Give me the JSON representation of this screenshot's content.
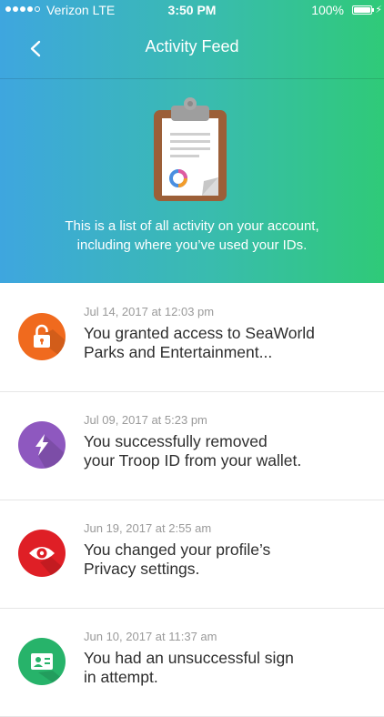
{
  "status_bar": {
    "carrier": "Verizon LTE",
    "time": "3:50 PM",
    "battery": "100%",
    "battery_level": 1.0
  },
  "nav": {
    "title": "Activity Feed",
    "back_icon": "chevron-left-icon"
  },
  "hero": {
    "icon": "clipboard-icon",
    "description_line1": "This is a list of all activity on your account,",
    "description_line2": "including where you’ve used your IDs."
  },
  "activity": [
    {
      "date": "Jul 14, 2017 at 12:03 pm",
      "line1": "You granted access to SeaWorld",
      "line2": "Parks and Entertainment...",
      "icon": "unlock-icon",
      "color": "#f06a1e"
    },
    {
      "date": "Jul 09, 2017 at 5:23 pm",
      "line1": "You successfully removed",
      "line2": "your Troop ID from your wallet.",
      "icon": "lightning-icon",
      "color": "#8e58bf"
    },
    {
      "date": "Jun 19, 2017 at 2:55 am",
      "line1": "You changed your profile’s",
      "line2": "Privacy settings.",
      "icon": "eye-icon",
      "color": "#df1f26"
    },
    {
      "date": "Jun 10, 2017 at 11:37 am",
      "line1": "You had an unsuccessful sign",
      "line2": "in attempt.",
      "icon": "id-card-icon",
      "color": "#27b36a"
    }
  ]
}
